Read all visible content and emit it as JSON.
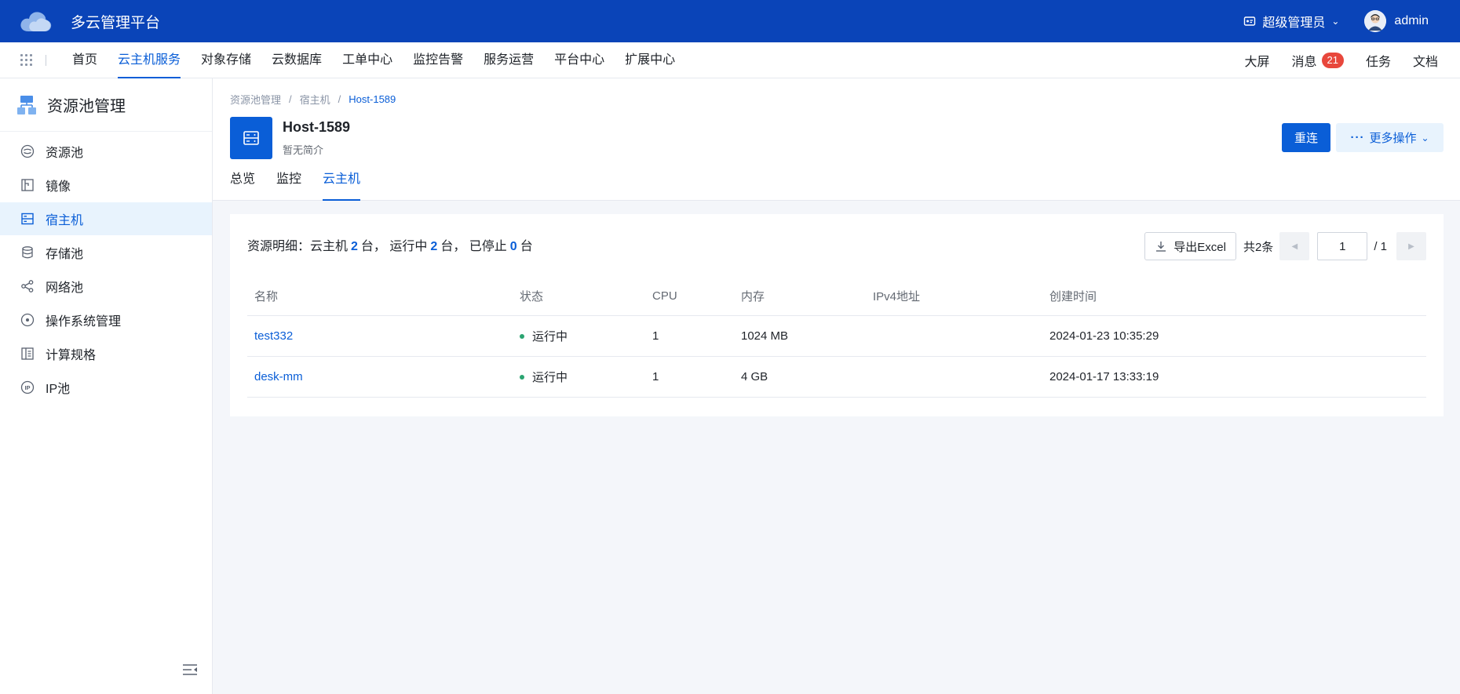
{
  "app": {
    "title": "多云管理平台"
  },
  "topbar": {
    "role_label": "超级管理员",
    "user_name": "admin"
  },
  "nav": {
    "items": [
      "首页",
      "云主机服务",
      "对象存储",
      "云数据库",
      "工单中心",
      "监控告警",
      "服务运营",
      "平台中心",
      "扩展中心"
    ],
    "active_index": 1,
    "right": {
      "screen": "大屏",
      "messages": "消息",
      "message_count": "21",
      "tasks": "任务",
      "docs": "文档"
    }
  },
  "sidebar": {
    "title": "资源池管理",
    "items": [
      {
        "label": "资源池",
        "icon": "resource-pool-icon"
      },
      {
        "label": "镜像",
        "icon": "image-icon"
      },
      {
        "label": "宿主机",
        "icon": "host-icon"
      },
      {
        "label": "存储池",
        "icon": "database-icon"
      },
      {
        "label": "网络池",
        "icon": "network-icon"
      },
      {
        "label": "操作系统管理",
        "icon": "os-icon"
      },
      {
        "label": "计算规格",
        "icon": "spec-icon"
      },
      {
        "label": "IP池",
        "icon": "ip-icon"
      }
    ],
    "active_index": 2
  },
  "breadcrumb": {
    "items": [
      "资源池管理",
      "宿主机"
    ],
    "current": "Host-1589"
  },
  "host": {
    "name": "Host-1589",
    "description": "暂无简介"
  },
  "actions": {
    "reconnect": "重连",
    "more": "更多操作"
  },
  "tabs": {
    "items": [
      "总览",
      "监控",
      "云主机"
    ],
    "active_index": 2
  },
  "summary": {
    "prefix": "资源明细：云主机",
    "vm_count": "2",
    "unit1": "台，",
    "running_label": "运行中",
    "running_count": "2",
    "unit2": "台，",
    "stopped_label": "已停止",
    "stopped_count": "0",
    "unit3": "台"
  },
  "toolbar": {
    "export_label": "导出Excel",
    "total": "共2条",
    "page": "1",
    "page_total": "/ 1"
  },
  "table": {
    "columns": [
      "名称",
      "状态",
      "CPU",
      "内存",
      "IPv4地址",
      "创建时间"
    ],
    "rows": [
      {
        "name": "test332",
        "status": "运行中",
        "cpu": "1",
        "memory": "1024 MB",
        "ipv4": "",
        "created": "2024-01-23 10:35:29"
      },
      {
        "name": "desk-mm",
        "status": "运行中",
        "cpu": "1",
        "memory": "4 GB",
        "ipv4": "",
        "created": "2024-01-17 13:33:19"
      }
    ]
  },
  "colors": {
    "topbar": "#0a44b8",
    "accent": "#0a5ed7",
    "badge": "#e8473c",
    "running": "#2ba471"
  }
}
